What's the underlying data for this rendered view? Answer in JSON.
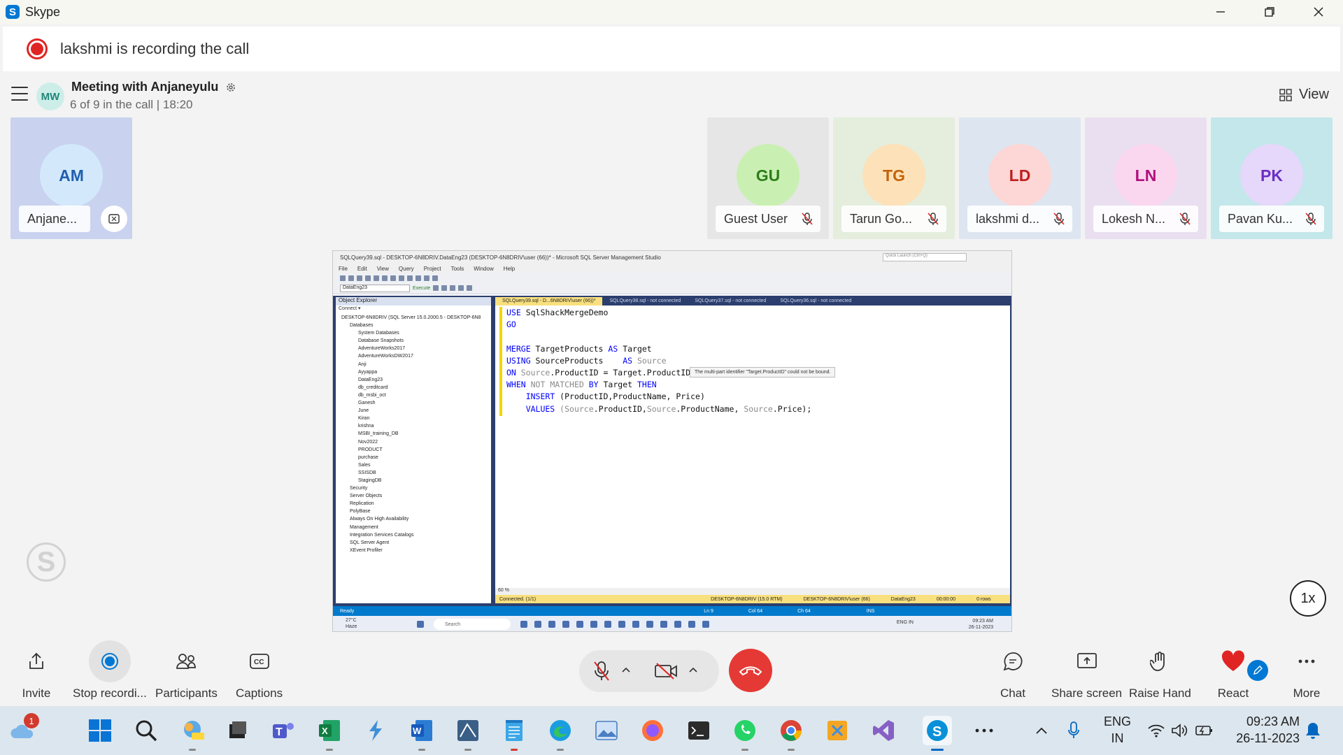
{
  "window": {
    "title": "Skype"
  },
  "banner": {
    "text": "lakshmi is recording the call"
  },
  "meeting": {
    "avatar": "MW",
    "title": "Meeting with Anjaneyulu",
    "subtitle": "6 of 9 in the call | 18:20",
    "view_label": "View"
  },
  "participants": [
    {
      "initials": "AM",
      "name": "Anjane...",
      "avatar_bg": "#d3e9fb",
      "avatar_fg": "#1f5fb0",
      "tile_bg": "#c9d2ef"
    },
    {
      "initials": "GU",
      "name": "Guest User",
      "avatar_bg": "#c9f0b2",
      "avatar_fg": "#2e7d1a",
      "tile_bg": "#e6e6e6"
    },
    {
      "initials": "TG",
      "name": "Tarun Go...",
      "avatar_bg": "#fde1b8",
      "avatar_fg": "#c2630a",
      "tile_bg": "#e5eedd"
    },
    {
      "initials": "LD",
      "name": "lakshmi d...",
      "avatar_bg": "#fdd6d6",
      "avatar_fg": "#c01e1e",
      "tile_bg": "#dde6f0"
    },
    {
      "initials": "LN",
      "name": "Lokesh N...",
      "avatar_bg": "#fbd7ef",
      "avatar_fg": "#b0107e",
      "tile_bg": "#e9dff0"
    },
    {
      "initials": "PK",
      "name": "Pavan Ku...",
      "avatar_bg": "#e5d8fa",
      "avatar_fg": "#6b2ec4",
      "tile_bg": "#c3e7ea"
    }
  ],
  "shared_screen": {
    "title": "SQLQuery39.sql - DESKTOP-6N8DRIV.DataEng23 (DESKTOP-6N8DRIV\\user (66))* - Microsoft SQL Server Management Studio",
    "quick_launch": "Quick Launch (Ctrl+Q)",
    "menu": [
      "File",
      "Edit",
      "View",
      "Query",
      "Project",
      "Tools",
      "Window",
      "Help"
    ],
    "database_select": "DataEng23",
    "execute_label": "Execute",
    "object_explorer": {
      "header": "Object Explorer",
      "connect": "Connect ▾",
      "server": "DESKTOP-6N8DRIV (SQL Server 15.0.2000.5 - DESKTOP-6N8",
      "databases_label": "Databases",
      "databases": [
        "System Databases",
        "Database Snapshots",
        "AdventureWorks2017",
        "AdventureWorksDW2017",
        "Anji",
        "Ayyappa",
        "DataEng23",
        "db_creditcard",
        "db_msbi_oct",
        "Ganesh",
        "June",
        "Kiran",
        "krishna",
        "MSBI_training_DB",
        "Nov2022",
        "PRODUCT",
        "purchase",
        "Sales",
        "SSISDB",
        "StagingDB"
      ],
      "folders": [
        "Security",
        "Server Objects",
        "Replication",
        "PolyBase",
        "Always On High Availability",
        "Management",
        "Integration Services Catalogs",
        "SQL Server Agent",
        "XEvent Profiler"
      ]
    },
    "tabs": [
      "SQLQuery39.sql - D...6N8DRIV\\user (66))*",
      "SQLQuery38.sql - not connected",
      "SQLQuery37.sql - not connected",
      "SQLQuery36.sql - not connected"
    ],
    "code": {
      "l1a": "USE",
      "l1b": " SqlShackMergeDemo",
      "l2": "GO",
      "l4a": "MERGE",
      "l4b": " TargetProducts ",
      "l4c": "AS",
      "l4d": " Target",
      "l5a": "USING",
      "l5b": " SourceProducts    ",
      "l5c": "AS",
      "l5d": " Source",
      "l6a": "ON",
      "l6b": " Source",
      "l6c": ".ProductID = Target.ProductID",
      "l7a": "WHEN",
      "l7b": " NOT MATCHED ",
      "l7c": "BY",
      "l7d": " Target ",
      "l7e": "THEN",
      "l8a": "    INSERT",
      "l8b": " (ProductID,ProductName, Price)",
      "l9a": "    VALUES",
      "l9b": " (",
      "l9c": "Source",
      "l9d": ".ProductID,",
      "l9e": "Source",
      "l9f": ".ProductName, ",
      "l9g": "Source",
      "l9h": ".Price);"
    },
    "tooltip": "The multi-part identifier \"Target.ProductID\" could not be bound.",
    "zoom": "60 %",
    "connected": "Connected. (1/1)",
    "ln": "Ln 9",
    "col": "Col 64",
    "ch": "Ch 64",
    "ins": "INS",
    "editor_server": "DESKTOP-6N8DRIV (15.0 RTM)",
    "editor_user": "DESKTOP-6N8DRIV\\user (66)",
    "editor_db": "DataEng23",
    "editor_time": "00:00:00",
    "editor_rows": "0 rows",
    "ready": "Ready",
    "weather_temp": "27°C",
    "weather_desc": "Haze",
    "inner_search": "Search",
    "inner_lang": "ENG IN",
    "inner_time": "09:23 AM",
    "inner_date": "26-11-2023"
  },
  "speed_label": "1x",
  "controls": {
    "invite": "Invite",
    "stop_recording": "Stop recordi...",
    "participants": "Participants",
    "captions": "Captions",
    "chat": "Chat",
    "share_screen": "Share screen",
    "raise_hand": "Raise Hand",
    "react": "React",
    "more": "More"
  },
  "taskbar": {
    "weather_badge": "1",
    "lang_line1": "ENG",
    "lang_line2": "IN",
    "time": "09:23 AM",
    "date": "26-11-2023"
  },
  "colors": {
    "accent_blue": "#0078d4",
    "record_red": "#e02424",
    "end_call_red": "#e53935"
  }
}
